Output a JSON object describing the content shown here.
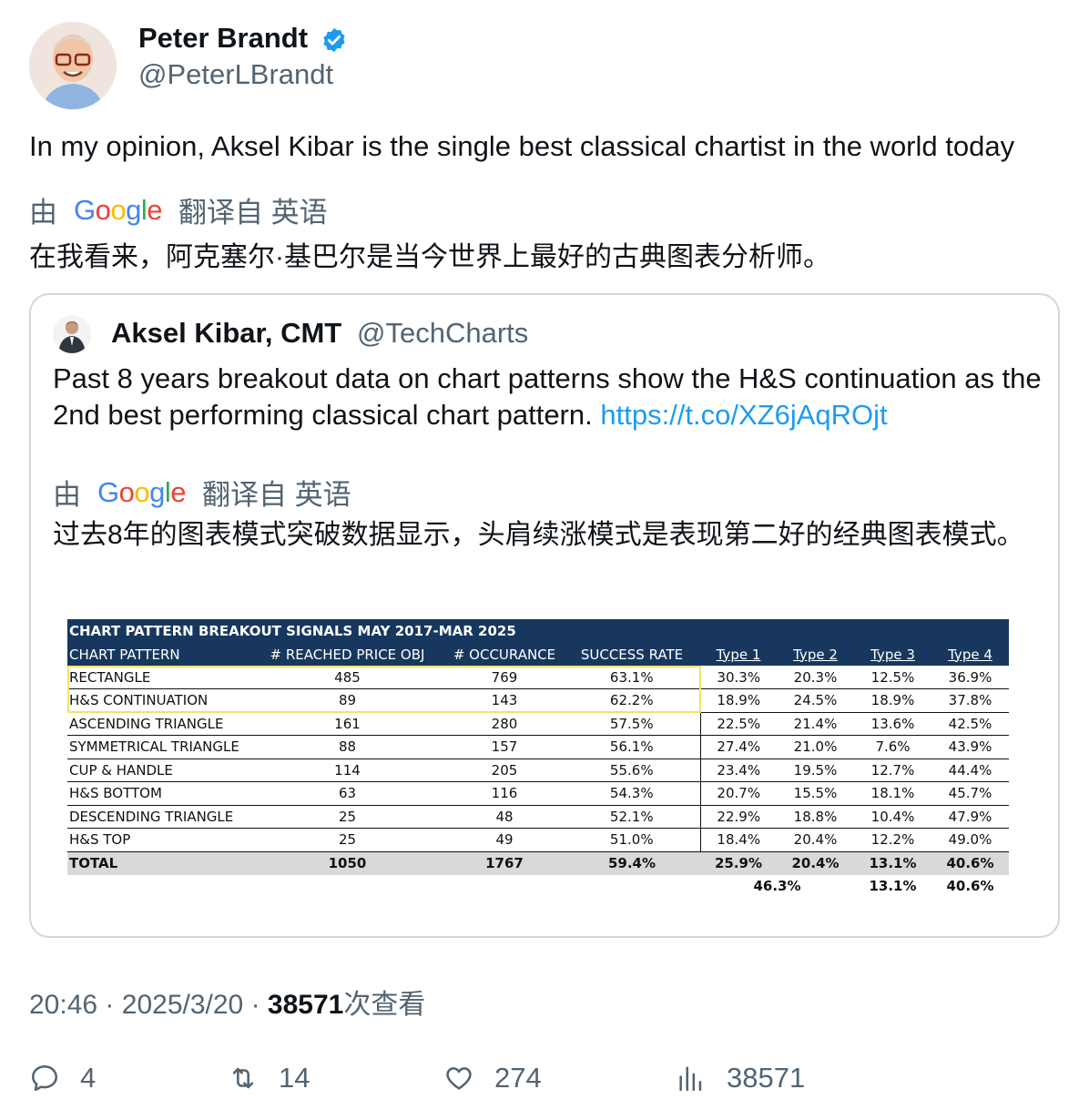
{
  "author": {
    "name": "Peter Brandt",
    "handle": "@PeterLBrandt",
    "verified_icon": "verified-badge-icon",
    "verified_color": "#1d9bf0"
  },
  "tweet": {
    "text": "In my opinion, Aksel Kibar is the single best classical chartist in the world today",
    "translated_by_prefix": "由",
    "translated_by_brand": "Google",
    "translated_from": "翻译自 英语",
    "translation": "在我看来，阿克塞尔·基巴尔是当今世界上最好的古典图表分析师。"
  },
  "quote": {
    "name": "Aksel Kibar, CMT",
    "handle": "@TechCharts",
    "text": "Past 8 years breakout data on chart patterns show the H&S continuation as the 2nd best performing classical chart pattern.",
    "link": "https://t.co/XZ6jAqROjt",
    "translated_by_prefix": "由",
    "translated_by_brand": "Google",
    "translated_from": "翻译自 英语",
    "translation": "过去8年的图表模式突破数据显示，头肩续涨模式是表现第二好的经典图表模式。"
  },
  "table": {
    "title": "CHART PATTERN BREAKOUT SIGNALS MAY 2017-MAR 2025",
    "headers": [
      "CHART PATTERN",
      "# REACHED PRICE OBJ",
      "# OCCURANCE",
      "SUCCESS RATE",
      "Type 1",
      "Type 2",
      "Type 3",
      "Type 4"
    ],
    "rows": [
      [
        "RECTANGLE",
        "485",
        "769",
        "63.1%",
        "30.3%",
        "20.3%",
        "12.5%",
        "36.9%"
      ],
      [
        "H&S CONTINUATION",
        "89",
        "143",
        "62.2%",
        "18.9%",
        "24.5%",
        "18.9%",
        "37.8%"
      ],
      [
        "ASCENDING TRIANGLE",
        "161",
        "280",
        "57.5%",
        "22.5%",
        "21.4%",
        "13.6%",
        "42.5%"
      ],
      [
        "SYMMETRICAL TRIANGLE",
        "88",
        "157",
        "56.1%",
        "27.4%",
        "21.0%",
        "7.6%",
        "43.9%"
      ],
      [
        "CUP & HANDLE",
        "114",
        "205",
        "55.6%",
        "23.4%",
        "19.5%",
        "12.7%",
        "44.4%"
      ],
      [
        "H&S BOTTOM",
        "63",
        "116",
        "54.3%",
        "20.7%",
        "15.5%",
        "18.1%",
        "45.7%"
      ],
      [
        "DESCENDING TRIANGLE",
        "25",
        "48",
        "52.1%",
        "22.9%",
        "18.8%",
        "10.4%",
        "47.9%"
      ],
      [
        "H&S TOP",
        "25",
        "49",
        "51.0%",
        "18.4%",
        "20.4%",
        "12.2%",
        "49.0%"
      ]
    ],
    "total": [
      "TOTAL",
      "1050",
      "1767",
      "59.4%",
      "25.9%",
      "20.4%",
      "13.1%",
      "40.6%"
    ],
    "subtotal": {
      "type12": "46.3%",
      "type3": "13.1%",
      "type4": "40.6%"
    }
  },
  "meta": {
    "time": "20:46",
    "sep": "·",
    "date": "2025/3/20",
    "views": "38571",
    "views_label": "次查看"
  },
  "actions": {
    "reply_count": "4",
    "retweet_count": "14",
    "like_count": "274",
    "views_count": "38571"
  }
}
